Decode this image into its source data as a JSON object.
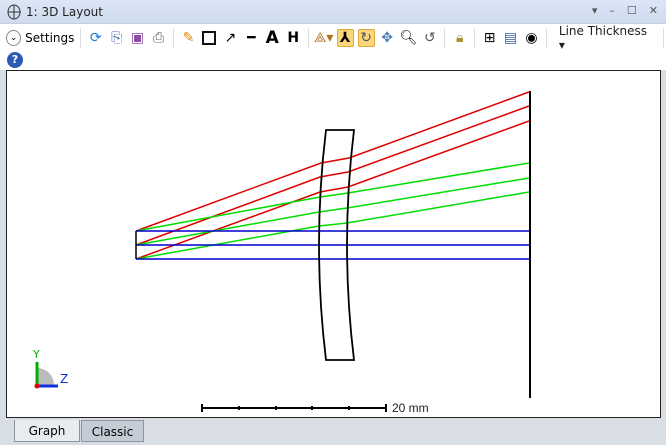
{
  "window": {
    "title": "1: 3D Layout"
  },
  "toolbar": {
    "settings_label": "Settings",
    "line_thickness_label": "Line Thickness"
  },
  "plot": {
    "scale_bar_label": "20 mm",
    "axis_labels": {
      "y": "Y",
      "z": "Z"
    },
    "colors": {
      "field1": "#0000cc",
      "field2": "#00dd00",
      "field3": "#e00000",
      "lens": "#000000"
    }
  },
  "tabs": [
    {
      "label": "Graph",
      "active": true
    },
    {
      "label": "Classic",
      "active": false
    }
  ]
}
